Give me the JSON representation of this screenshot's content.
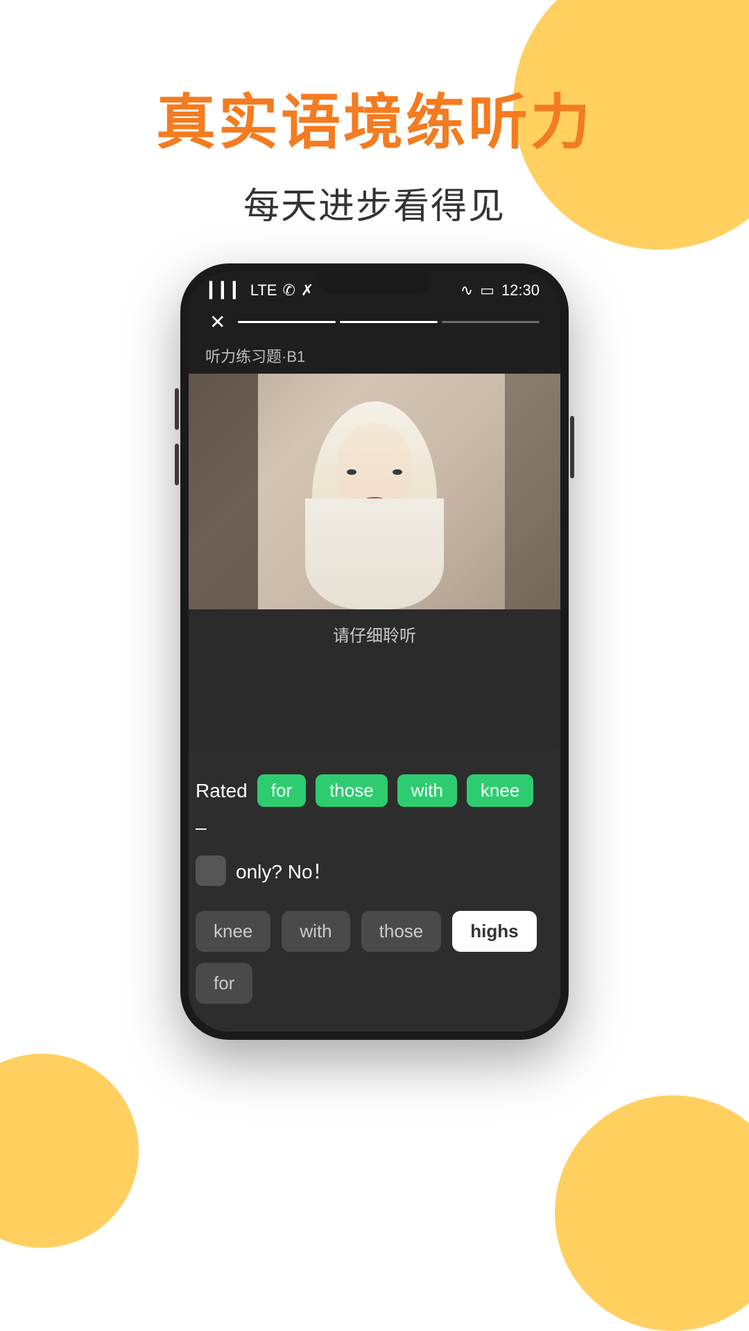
{
  "page": {
    "background_color": "#ffffff",
    "accent_color": "#FFC844",
    "title_color": "#F47B20"
  },
  "header": {
    "main_title": "真实语境练听力",
    "sub_title": "每天进步看得见"
  },
  "phone": {
    "status_bar": {
      "signal": "▎▎▎",
      "network": "LTE",
      "time": "12:30",
      "battery": "□"
    },
    "progress": {
      "close_icon": "✕",
      "segments": 3
    },
    "level_label": "听力练习题·B1",
    "listen_prompt": "请仔细聆听",
    "answer": {
      "rated_label": "Rated",
      "chips_green": [
        "for",
        "those",
        "with",
        "knee"
      ],
      "dash": "–",
      "only_text": "only?  No！",
      "word_options": [
        {
          "label": "knee",
          "selected": false
        },
        {
          "label": "with",
          "selected": false
        },
        {
          "label": "those",
          "selected": false
        },
        {
          "label": "highs",
          "selected": true
        },
        {
          "label": "for",
          "selected": false
        }
      ]
    }
  }
}
